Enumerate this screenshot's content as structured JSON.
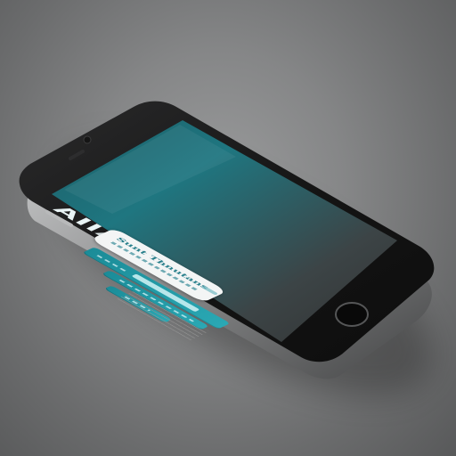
{
  "scene": {
    "subject": "smartphone",
    "colors": {
      "background": "#8b8c8d",
      "phone_frame": "#1b1b1c",
      "screen_teal": "#1f7680",
      "accent_teal": "#2aa8b4",
      "card_white": "#f3f5f5"
    }
  },
  "app_screen": {
    "title": "AIIA",
    "card_text": "Sunt Thnutans"
  },
  "icons": [
    "camera-icon",
    "speaker-icon",
    "home-button-icon",
    "side-button-icon"
  ]
}
